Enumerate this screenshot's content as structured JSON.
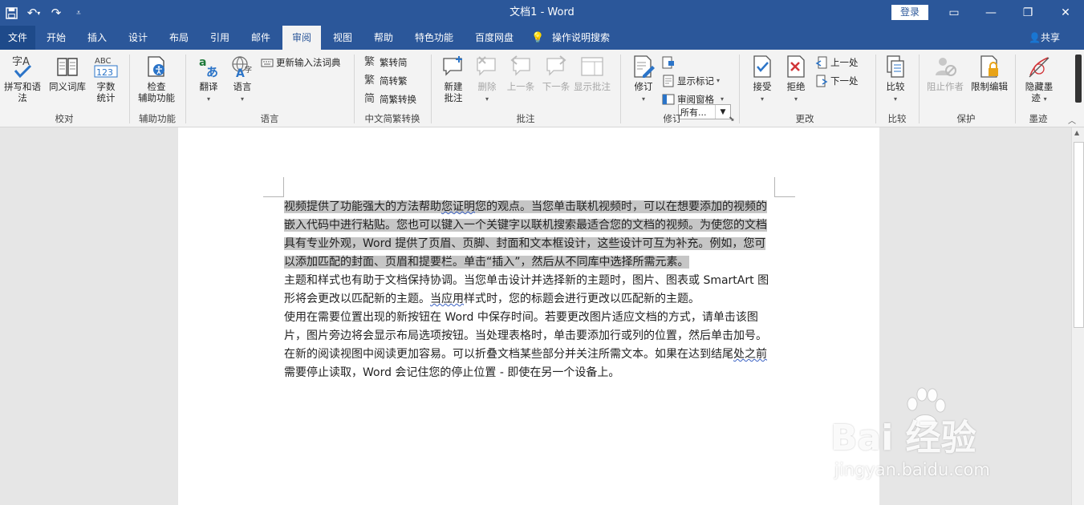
{
  "titlebar": {
    "title": "文档1  -  Word",
    "login": "登录",
    "qat": [
      "save-icon",
      "undo-icon",
      "redo-icon",
      "customize-icon"
    ]
  },
  "tabs": [
    "文件",
    "开始",
    "插入",
    "设计",
    "布局",
    "引用",
    "邮件",
    "审阅",
    "视图",
    "帮助",
    "特色功能",
    "百度网盘",
    "操作说明搜索"
  ],
  "active_tab": "审阅",
  "share": "共享",
  "ribbon": {
    "proofing": {
      "spell": "拼写和语法",
      "thesaurus": "同义词库",
      "wordcount_1": "字数",
      "wordcount_2": "统计",
      "group": "校对"
    },
    "accessibility": {
      "check_1": "检查",
      "check_2": "辅助功能",
      "group": "辅助功能"
    },
    "language": {
      "translate": "翻译",
      "language": "语言",
      "update_ime": "更新输入法词典",
      "group": "语言"
    },
    "chinese": {
      "t2s": "繁转简",
      "s2t": "简转繁",
      "convert": "简繁转换",
      "group": "中文简繁转换"
    },
    "comments": {
      "new_1": "新建",
      "new_2": "批注",
      "delete": "删除",
      "prev": "上一条",
      "next": "下一条",
      "show": "显示批注",
      "group": "批注"
    },
    "tracking": {
      "track": "修订",
      "combo": "所有...",
      "show_markup": "显示标记",
      "review_pane": "审阅窗格",
      "group": "修订"
    },
    "changes": {
      "accept": "接受",
      "reject": "拒绝",
      "prev": "上一处",
      "next": "下一处",
      "group": "更改"
    },
    "compare": {
      "compare": "比较",
      "group": "比较"
    },
    "protect": {
      "block": "阻止作者",
      "restrict": "限制编辑",
      "group": "保护"
    },
    "ink": {
      "hide_1": "隐藏墨",
      "hide_2": "迹",
      "group": "墨迹"
    }
  },
  "document": {
    "p1": {
      "a": "视频提供了功能强大的方法帮助",
      "squig": "您证明",
      "b": "您的观点。当您单击联机视频时，可以在想要添加的视频的嵌入代码中进行粘贴。您也可以键入一个关键字以联机搜索最适合您的文档的视频。为使您的文档具有专业外观，Word 提供了页眉、页脚、封面和文本框设计，这些设计可互为补充。例如，您可以添加匹配的封面、页眉和提要栏。单击“插入”，然后从不同库中选择所需元素。"
    },
    "p2": {
      "a": "主题和样式也有助于文档保持协调。当您单击设计并选择新的主题时，图片、图表或 SmartArt 图形将会更改以匹配新的主题。",
      "squig": "当应用",
      "b": "样式时，您的标题会进行更改以匹配新的主题。"
    },
    "p3": "使用在需要位置出现的新按钮在 Word 中保存时间。若要更改图片适应文档的方式，请单击该图片，图片旁边将会显示布局选项按钮。当处理表格时，单击要添加行或列的位置，然后单击加号。",
    "p4": {
      "a": "在新的阅读视图中阅读更加容易。可以折叠文档某些部分并关注所需文本。如果在达到结尾",
      "squig": "处之前",
      "b": "需要停止读取，Word 会记住您的停止位置 - 即使在另一个设备上。"
    }
  },
  "watermark": {
    "brand": "Bai 经验",
    "site": "jingyan.baidu.com"
  }
}
